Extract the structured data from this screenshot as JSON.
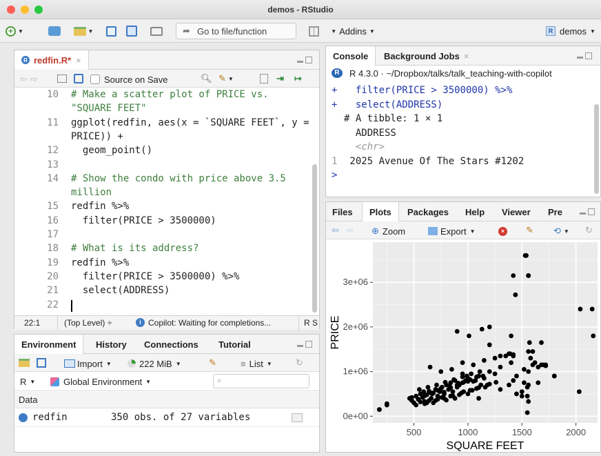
{
  "window": {
    "title": "demos - RStudio"
  },
  "toolbar": {
    "goto_placeholder": "Go to file/function",
    "addins_label": "Addins",
    "project_label": "demos"
  },
  "editor": {
    "tab_label": "redfin.R*",
    "source_on_save_label": "Source on Save",
    "lines": [
      {
        "n": "10",
        "text": "# Make a scatter plot of PRICE vs."
      },
      {
        "n": "",
        "text": "\"SQUARE FEET\""
      },
      {
        "n": "11",
        "text": "ggplot(redfin, aes(x = `SQUARE FEET`, y ="
      },
      {
        "n": "",
        "text": "PRICE)) +"
      },
      {
        "n": "12",
        "text": "  geom_point()"
      },
      {
        "n": "13",
        "text": ""
      },
      {
        "n": "14",
        "text": "# Show the condo with price above 3.5"
      },
      {
        "n": "",
        "text": "million"
      },
      {
        "n": "15",
        "text": "redfin %>%"
      },
      {
        "n": "16",
        "text": "  filter(PRICE > 3500000)"
      },
      {
        "n": "17",
        "text": ""
      },
      {
        "n": "18",
        "text": "# What is its address?"
      },
      {
        "n": "19",
        "text": "redfin %>%"
      },
      {
        "n": "20",
        "text": "  filter(PRICE > 3500000) %>%"
      },
      {
        "n": "21",
        "text": "  select(ADDRESS)"
      },
      {
        "n": "22",
        "text": ""
      }
    ],
    "status_position": "22:1",
    "status_scope": "(Top Level) ÷",
    "status_copilot": "Copilot: Waiting for completions...",
    "status_lang": "R S"
  },
  "console": {
    "tab_console": "Console",
    "tab_jobs": "Background Jobs",
    "path": "R 4.3.0 · ~/Dropbox/talks/talk_teaching-with-copilot",
    "lines": [
      {
        "prefix": "+",
        "text": "  filter(PRICE > 3500000) %>%"
      },
      {
        "prefix": "+",
        "text": "  select(ADDRESS)"
      },
      {
        "prefix": "",
        "text": "# A tibble: 1 × 1"
      },
      {
        "prefix": "",
        "text": "  ADDRESS"
      },
      {
        "prefix": "",
        "text": "  <chr>"
      },
      {
        "prefix": "1",
        "text": " 2025 Avenue Of The Stars #1202"
      },
      {
        "prefix": ">",
        "text": ""
      }
    ]
  },
  "environment": {
    "tabs": [
      "Environment",
      "History",
      "Connections",
      "Tutorial"
    ],
    "import_label": "Import",
    "memory": "222 MiB",
    "list_label": "List",
    "lang": "R",
    "scope": "Global Environment",
    "section": "Data",
    "rows": [
      {
        "name": "redfin",
        "value": "350 obs. of 27 variables"
      }
    ]
  },
  "files": {
    "tabs": [
      "Files",
      "Plots",
      "Packages",
      "Help",
      "Viewer",
      "Pre"
    ],
    "zoom_label": "Zoom",
    "export_label": "Export"
  },
  "chart_data": {
    "type": "scatter",
    "xlabel": "SQUARE FEET",
    "ylabel": "PRICE",
    "xlim": [
      120,
      2200
    ],
    "ylim": [
      -150000,
      3900000
    ],
    "xticks": [
      500,
      1000,
      1500,
      2000
    ],
    "xtick_labels": [
      "500",
      "1000",
      "1500",
      "2000"
    ],
    "yticks": [
      0,
      1000000,
      2000000,
      3000000
    ],
    "ytick_labels": [
      "0e+00",
      "1e+06",
      "2e+06",
      "3e+06"
    ],
    "x": [
      180,
      250,
      460,
      480,
      500,
      520,
      540,
      560,
      580,
      600,
      620,
      640,
      660,
      680,
      700,
      720,
      740,
      760,
      780,
      800,
      820,
      840,
      860,
      880,
      900,
      920,
      950,
      980,
      1000,
      1050,
      1100,
      1150,
      1200,
      1250,
      520,
      560,
      600,
      640,
      680,
      720,
      760,
      800,
      840,
      880,
      920,
      960,
      1000,
      1040,
      1080,
      1120,
      1160,
      1200,
      550,
      590,
      630,
      670,
      710,
      750,
      790,
      830,
      870,
      910,
      950,
      990,
      1030,
      1070,
      1110,
      480,
      540,
      600,
      660,
      720,
      780,
      840,
      900,
      960,
      1020,
      1080,
      1140,
      620,
      700,
      780,
      860,
      940,
      1020,
      1100,
      1180,
      1260,
      650,
      750,
      850,
      950,
      1050,
      1150,
      1250,
      1350,
      1300,
      1380,
      1420,
      1450,
      1500,
      1520,
      1550,
      1560,
      1580,
      1600,
      1620,
      1650,
      1700,
      1800,
      1420,
      1380,
      1300,
      1560,
      1450,
      1500,
      1100,
      950,
      1000,
      900,
      1200,
      1520,
      1400,
      2030,
      2150,
      1400,
      1560,
      1540,
      1560,
      1680,
      1720
    ],
    "y": [
      150000,
      280000,
      400000,
      350000,
      300000,
      450000,
      380000,
      500000,
      420000,
      330000,
      480000,
      560000,
      400000,
      520000,
      600000,
      450000,
      550000,
      650000,
      500000,
      700000,
      600000,
      750000,
      550000,
      800000,
      650000,
      700000,
      750000,
      800000,
      850000,
      780000,
      900000,
      850000,
      1000000,
      950000,
      250000,
      320000,
      280000,
      350000,
      300000,
      380000,
      420000,
      360000,
      450000,
      400000,
      480000,
      550000,
      500000,
      580000,
      620000,
      700000,
      650000,
      720000,
      600000,
      550000,
      650000,
      500000,
      700000,
      620000,
      760000,
      680000,
      820000,
      740000,
      880000,
      900000,
      950000,
      800000,
      1000000,
      420000,
      380000,
      460000,
      520000,
      580000,
      540000,
      640000,
      700000,
      760000,
      820000,
      880000,
      900000,
      300000,
      350000,
      400000,
      460000,
      520000,
      580000,
      640000,
      700000,
      760000,
      1100000,
      1000000,
      1050000,
      1200000,
      1150000,
      1250000,
      1300000,
      1350000,
      600000,
      700000,
      800000,
      900000,
      550000,
      750000,
      650000,
      1000000,
      1300000,
      1450000,
      1200000,
      1100000,
      1150000,
      900000,
      1350000,
      1400000,
      1100000,
      700000,
      500000,
      450000,
      400000,
      950000,
      780000,
      1900000,
      1600000,
      1050000,
      1200000,
      550000,
      2400000,
      1800000,
      3150000,
      3600000,
      3150000,
      1650000,
      1150000
    ],
    "marks": [
      [
        1530,
        3600000
      ],
      [
        1560,
        3150000
      ],
      [
        1420,
        3150000
      ],
      [
        1440,
        2720000
      ],
      [
        1200,
        2000000
      ],
      [
        1130,
        1950000
      ],
      [
        1010,
        1800000
      ],
      [
        2040,
        2400000
      ],
      [
        2160,
        1800000
      ],
      [
        1570,
        1650000
      ],
      [
        1560,
        1450000
      ],
      [
        1390,
        1400000
      ],
      [
        1420,
        1380000
      ],
      [
        1300,
        1350000
      ],
      [
        1600,
        1150000
      ],
      [
        1680,
        1150000
      ],
      [
        1720,
        1130000
      ],
      [
        1800,
        900000
      ],
      [
        1650,
        750000
      ],
      [
        1550,
        450000
      ],
      [
        1560,
        330000
      ],
      [
        1550,
        80000
      ],
      [
        180,
        150000
      ],
      [
        250,
        250000
      ]
    ],
    "grid": true
  }
}
